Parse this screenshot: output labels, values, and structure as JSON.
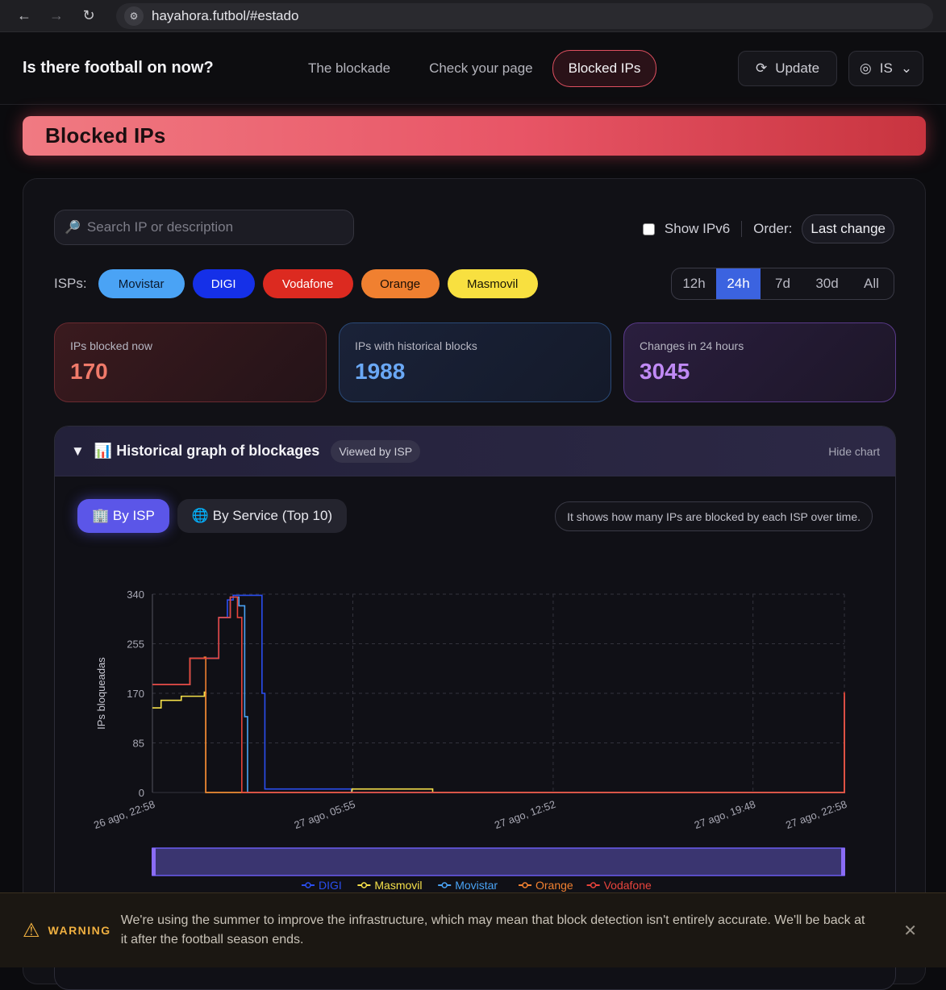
{
  "browser": {
    "url": "hayahora.futbol/#estado"
  },
  "header": {
    "site_title": "Is there football on now?",
    "nav": [
      "The blockade",
      "Check your page",
      "Blocked IPs"
    ],
    "update_label": "Update",
    "lang_label": "IS"
  },
  "banner": {
    "title": "Blocked IPs"
  },
  "filters": {
    "search_placeholder": "Search IP or description",
    "show_ipv6_label": "Show IPv6",
    "order_label": "Order:",
    "order_value": "Last change",
    "isps_label": "ISPs:",
    "isps": [
      {
        "name": "Movistar",
        "color": "#4aa3f5",
        "text": "#0b1a2e"
      },
      {
        "name": "DIGI",
        "color": "#1530e8",
        "text": "#ffffff"
      },
      {
        "name": "Vodafone",
        "color": "#dc2a20",
        "text": "#ffffff"
      },
      {
        "name": "Orange",
        "color": "#f08030",
        "text": "#1a0e05"
      },
      {
        "name": "Masmovil",
        "color": "#f8e040",
        "text": "#1a1705"
      }
    ],
    "ranges": [
      "12h",
      "24h",
      "7d",
      "30d",
      "All"
    ],
    "range_selected": "24h"
  },
  "stats": {
    "blocked_now": {
      "label": "IPs blocked now",
      "value": "170"
    },
    "historical": {
      "label": "IPs with historical blocks",
      "value": "1988"
    },
    "changes": {
      "label": "Changes in 24 hours",
      "value": "3045"
    }
  },
  "chart_panel": {
    "toggle": "▼",
    "title": "📊 Historical graph of blockages",
    "badge": "Viewed by ISP",
    "hide_label": "Hide chart",
    "tab_isp": "🏢 By ISP",
    "tab_service": "🌐 By Service (Top 10)",
    "hint": "It shows how many IPs are blocked by each ISP over time."
  },
  "chart_data": {
    "type": "line",
    "ylabel": "IPs bloqueadas",
    "ylim": [
      0,
      340
    ],
    "yticks": [
      0,
      85,
      170,
      255,
      340
    ],
    "xticks": [
      "26 ago, 22:58",
      "27 ago, 05:55",
      "27 ago, 12:52",
      "27 ago, 19:48",
      "27 ago, 22:58"
    ],
    "x_hours_ticks": [
      0,
      6.95,
      13.9,
      20.83,
      24
    ],
    "grid": true,
    "legend_position": "bottom",
    "series": [
      {
        "name": "DIGI",
        "color": "#2a4ef0",
        "points": [
          [
            0,
            185
          ],
          [
            1.3,
            230
          ],
          [
            2.3,
            300
          ],
          [
            2.6,
            330
          ],
          [
            2.8,
            338
          ],
          [
            3.6,
            338
          ],
          [
            3.8,
            170
          ],
          [
            3.9,
            6
          ],
          [
            6.8,
            6
          ],
          [
            6.9,
            0
          ],
          [
            23.6,
            0
          ],
          [
            24,
            165
          ]
        ]
      },
      {
        "name": "Masmovil",
        "color": "#f5e04a",
        "points": [
          [
            0,
            145
          ],
          [
            0.3,
            158
          ],
          [
            1.0,
            165
          ],
          [
            1.8,
            172
          ],
          [
            1.85,
            0
          ],
          [
            6.9,
            0
          ],
          [
            6.92,
            6
          ],
          [
            9.7,
            6
          ],
          [
            9.72,
            0
          ],
          [
            23.8,
            0
          ],
          [
            24,
            120
          ]
        ]
      },
      {
        "name": "Movistar",
        "color": "#4aa3f5",
        "points": [
          [
            0,
            185
          ],
          [
            1.3,
            230
          ],
          [
            2.3,
            300
          ],
          [
            2.7,
            335
          ],
          [
            3.0,
            320
          ],
          [
            3.2,
            130
          ],
          [
            3.3,
            0
          ],
          [
            23.4,
            0
          ],
          [
            24,
            160
          ]
        ]
      },
      {
        "name": "Orange",
        "color": "#f08030",
        "points": [
          [
            0,
            185
          ],
          [
            1.3,
            230
          ],
          [
            1.8,
            232
          ],
          [
            1.85,
            0
          ],
          [
            23.4,
            0
          ],
          [
            24,
            170
          ]
        ]
      },
      {
        "name": "Vodafone",
        "color": "#e8443c",
        "points": [
          [
            0,
            185
          ],
          [
            1.3,
            230
          ],
          [
            2.3,
            300
          ],
          [
            2.7,
            335
          ],
          [
            2.95,
            300
          ],
          [
            3.1,
            0
          ],
          [
            23.4,
            0
          ],
          [
            24,
            172
          ]
        ]
      }
    ]
  },
  "warning": {
    "label": "WARNING",
    "text": "We're using the summer to improve the infrastructure, which may mean that block detection isn't entirely accurate. We'll be back at it after the football season ends."
  }
}
